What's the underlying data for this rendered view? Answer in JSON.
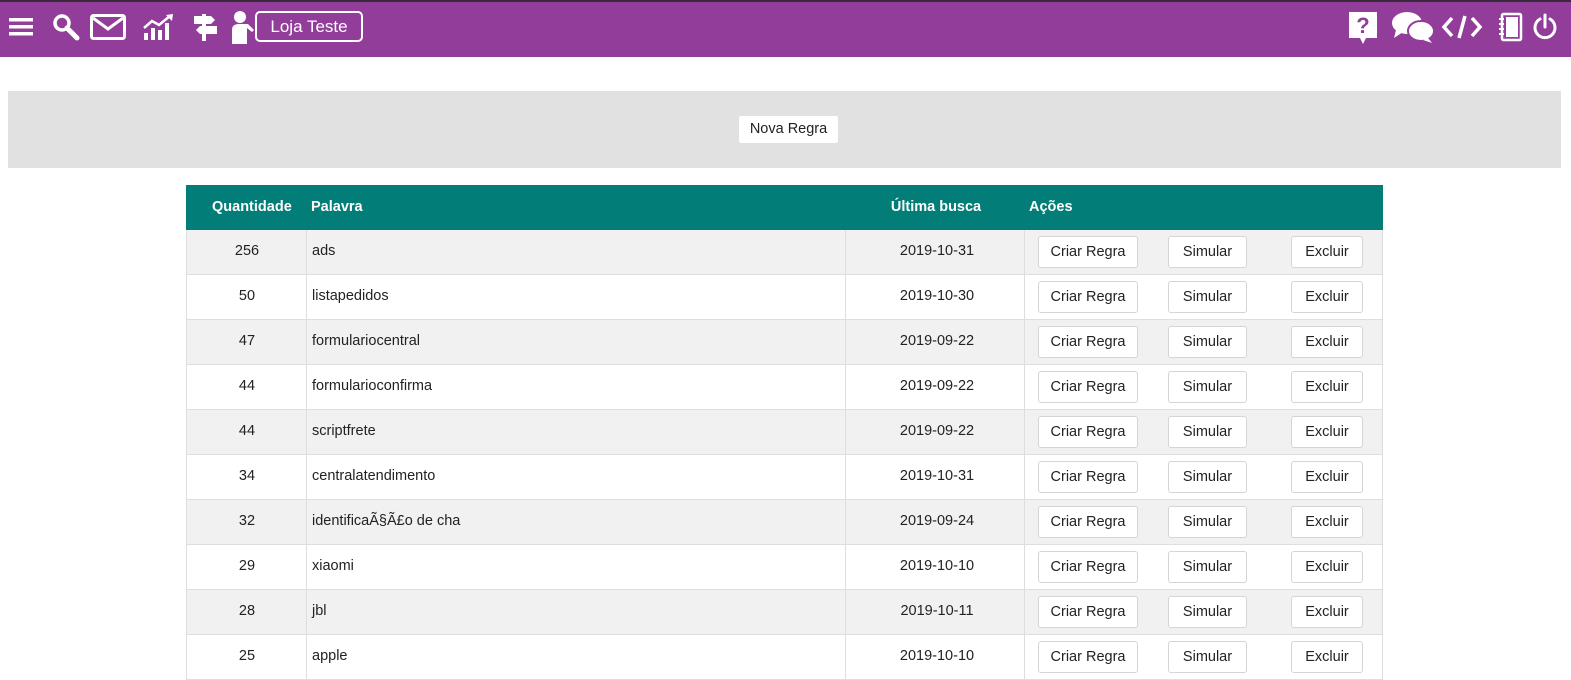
{
  "header": {
    "store_label": "Loja Teste",
    "background_color": "#933d9b",
    "left_icons": [
      "menu-icon",
      "search-icon",
      "mail-icon",
      "chart-icon",
      "signpost-icon",
      "user-presenter-icon"
    ],
    "right_icons": [
      "help-icon",
      "chat-icon",
      "code-icon",
      "notebook-icon",
      "power-icon"
    ]
  },
  "toolbar": {
    "new_rule_label": "Nova Regra"
  },
  "table": {
    "header_color": "#027d77",
    "columns": {
      "quantity": "Quantidade",
      "word": "Palavra",
      "last_search": "Última busca",
      "actions": "Ações"
    },
    "actions": {
      "create": "Criar Regra",
      "simulate": "Simular",
      "delete": "Excluir"
    },
    "rows": [
      {
        "quantity": "256",
        "word": "ads",
        "last_search": "2019-10-31"
      },
      {
        "quantity": "50",
        "word": "listapedidos",
        "last_search": "2019-10-30"
      },
      {
        "quantity": "47",
        "word": "formulariocentral",
        "last_search": "2019-09-22"
      },
      {
        "quantity": "44",
        "word": "formularioconfirma",
        "last_search": "2019-09-22"
      },
      {
        "quantity": "44",
        "word": "scriptfrete",
        "last_search": "2019-09-22"
      },
      {
        "quantity": "34",
        "word": "centralatendimento",
        "last_search": "2019-10-31"
      },
      {
        "quantity": "32",
        "word": "identificaÃ§Ã£o de cha",
        "last_search": "2019-09-24"
      },
      {
        "quantity": "29",
        "word": "xiaomi",
        "last_search": "2019-10-10"
      },
      {
        "quantity": "28",
        "word": "jbl",
        "last_search": "2019-10-11"
      },
      {
        "quantity": "25",
        "word": "apple",
        "last_search": "2019-10-10"
      }
    ]
  }
}
